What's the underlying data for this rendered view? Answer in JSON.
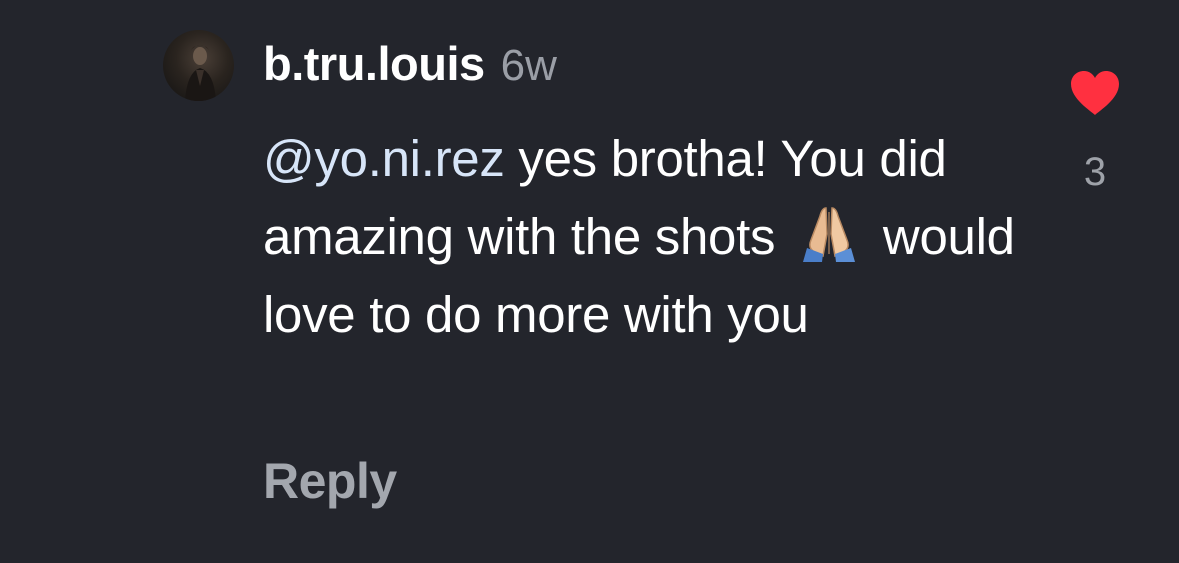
{
  "comment": {
    "username": "b.tru.louis",
    "timestamp": "6w",
    "mention": "@yo.ni.rez",
    "text_before_emoji": " yes brotha! You did amazing with the shots",
    "emoji_name": "folded-hands-emoji",
    "text_after_emoji": "would love to do more with you",
    "reply_label": "Reply",
    "like_count": "3",
    "like_icon": "heart-icon",
    "like_color": "#ff3040"
  }
}
